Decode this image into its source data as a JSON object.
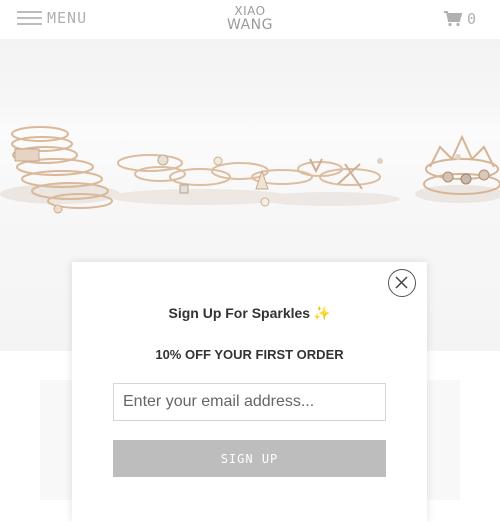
{
  "header": {
    "menu_label": "MENU",
    "logo_line1": "XIAO",
    "logo_line2": "WANG",
    "cart_count": "0"
  },
  "popup": {
    "title": "Sign Up For Sparkles",
    "title_emoji": "✨",
    "offer": "10% OFF YOUR FIRST ORDER",
    "email_placeholder": "Enter your email address...",
    "email_value": "",
    "submit_label": "SIGN UP"
  },
  "colors": {
    "header_text": "#b0b0b0",
    "button_gray": "#bdbdbd",
    "sparkle": "#e8c84a"
  }
}
